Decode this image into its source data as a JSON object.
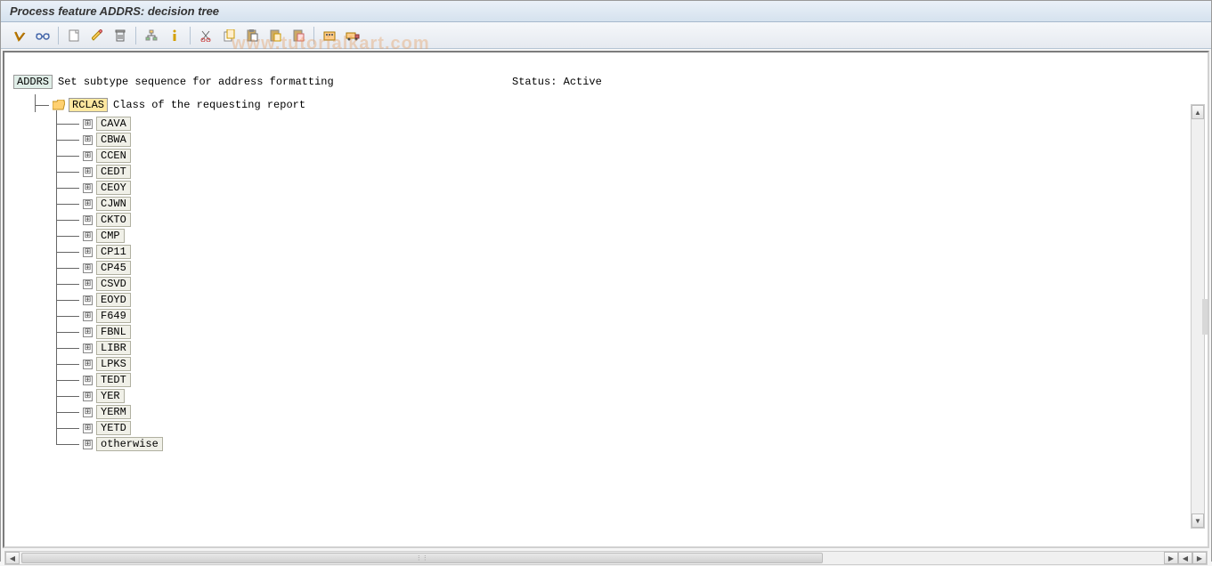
{
  "title": "Process feature ADDRS: decision tree",
  "watermark": "www.tutorialkart.com",
  "root": {
    "code": "ADDRS",
    "description": "Set subtype sequence for address formatting",
    "status_label": "Status:",
    "status_value": "Active"
  },
  "branch": {
    "code": "RCLAS",
    "description": "Class of the requesting report"
  },
  "children": [
    {
      "label": "CAVA"
    },
    {
      "label": "CBWA"
    },
    {
      "label": "CCEN"
    },
    {
      "label": "CEDT"
    },
    {
      "label": "CEOY"
    },
    {
      "label": "CJWN"
    },
    {
      "label": "CKTO"
    },
    {
      "label": "CMP"
    },
    {
      "label": "CP11"
    },
    {
      "label": "CP45"
    },
    {
      "label": "CSVD"
    },
    {
      "label": "EOYD"
    },
    {
      "label": "F649"
    },
    {
      "label": "FBNL"
    },
    {
      "label": "LIBR"
    },
    {
      "label": "LPKS"
    },
    {
      "label": "TEDT"
    },
    {
      "label": "YER"
    },
    {
      "label": "YERM"
    },
    {
      "label": "YETD"
    },
    {
      "label": "otherwise"
    }
  ],
  "toolbar_icons": [
    "check-icon",
    "glasses-icon",
    "new-icon",
    "edit-icon",
    "delete-icon",
    "hierarchy-icon",
    "info-icon",
    "cut-icon",
    "copy-icon",
    "paste-icon",
    "pin-icon",
    "unpin-icon",
    "container-icon",
    "transport-icon"
  ]
}
